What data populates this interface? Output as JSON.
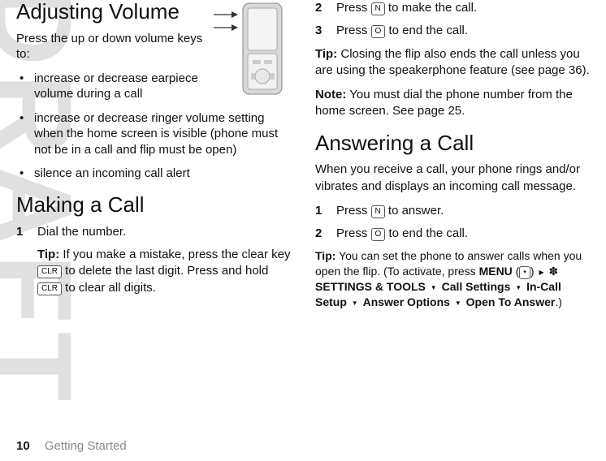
{
  "watermark": "DRAFT",
  "left": {
    "adjusting_title": "Adjusting Volume",
    "adjusting_intro": "Press the up or down volume keys to:",
    "bullets": [
      "increase or decrease earpiece volume during a call",
      "increase or decrease ringer volume setting when the home screen is visible (phone must not be in a call and flip must be open)",
      "silence an incoming call alert"
    ],
    "making_title": "Making a Call",
    "step1_num": "1",
    "step1_text": "Dial the number.",
    "tip_label": "Tip:",
    "tip_pre": " If you make a mistake, press the clear key ",
    "tip_mid": " to delete the last digit. Press and hold ",
    "tip_post": " to clear all digits.",
    "clr_key": "CLR"
  },
  "right": {
    "step2_num": "2",
    "step2_pre": "Press ",
    "step2_key": "N",
    "step2_post": " to make the call.",
    "step3_num": "3",
    "step3_pre": "Press ",
    "step3_key": "O",
    "step3_post": " to end the call.",
    "tip_label": "Tip:",
    "tip_text": " Closing the flip also ends the call unless you are using the speakerphone feature (see page 36).",
    "note_label": "Note:",
    "note_text": " You must dial the phone number from the home screen. See page 25.",
    "answering_title": "Answering a Call",
    "answering_intro": "When you receive a call, your phone rings and/or vibrates and displays an incoming call message.",
    "astep1_num": "1",
    "astep1_pre": "Press ",
    "astep1_key": "N",
    "astep1_post": " to answer.",
    "astep2_num": "2",
    "astep2_pre": "Press ",
    "astep2_key": "O",
    "astep2_post": " to end the call.",
    "tip2_label": "Tip:",
    "tip2_pre": " You can set the phone to answer calls when you open the flip. (To activate, press ",
    "menu_label": "MENU",
    "menu_paren_open": " (",
    "menu_key": "•",
    "menu_paren_close": ") ",
    "path_settings": "SETTINGS & TOOLS",
    "path_call": "Call Settings",
    "path_incall": "In-Call Setup",
    "path_answer": "Answer Options",
    "path_open": "Open To Answer",
    "path_end": ".)",
    "tools_icon": "✽"
  },
  "footer": {
    "page": "10",
    "section": "Getting Started"
  }
}
